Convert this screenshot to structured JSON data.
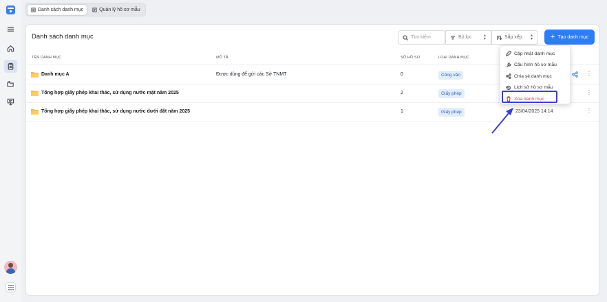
{
  "tabs": [
    {
      "label": "Danh sách danh mục",
      "active": true
    },
    {
      "label": "Quản lý hồ sơ mẫu",
      "active": false
    }
  ],
  "page": {
    "title": "Danh sách danh mục",
    "search_placeholder": "Tìm kiếm",
    "filter_label": "Bộ lọc",
    "sort_label": "Sắp xếp",
    "create_label": "Tạo danh mục"
  },
  "table": {
    "columns": [
      "TÊN DANH MỤC",
      "MÔ TẢ",
      "SỐ HỒ SƠ",
      "LOẠI DANH MỤC"
    ],
    "rows": [
      {
        "name": "Danh mục A",
        "desc": "Được dùng để gửi các Sở TNMT",
        "count": "0",
        "type": "Công văn",
        "date": ""
      },
      {
        "name": "Tổng hợp giấy phép khai thác, sử dụng nước mặt năm 2025",
        "desc": "",
        "count": "2",
        "type": "Giấy phép",
        "date": ""
      },
      {
        "name": "Tổng hợp giấy phép khai thác, sử dụng nước dưới đất năm 2025",
        "desc": "",
        "count": "1",
        "type": "Giấy phép",
        "date": "23/04/2025 14:14"
      }
    ]
  },
  "context_menu": {
    "items": [
      {
        "label": "Cập nhật danh mục",
        "icon": "pencil-icon"
      },
      {
        "label": "Cấu hình hồ sơ mẫu",
        "icon": "wrench-icon"
      },
      {
        "label": "Chia sẻ danh mục",
        "icon": "share-icon"
      },
      {
        "label": "Lịch sử hồ sơ mẫu",
        "icon": "history-icon"
      },
      {
        "label": "Xóa danh mục",
        "icon": "trash-icon",
        "danger": true
      }
    ]
  },
  "colors": {
    "accent": "#2e7cf6",
    "danger": "#d84545",
    "highlight": "#3b3fd0",
    "folder": "#f5b942"
  }
}
